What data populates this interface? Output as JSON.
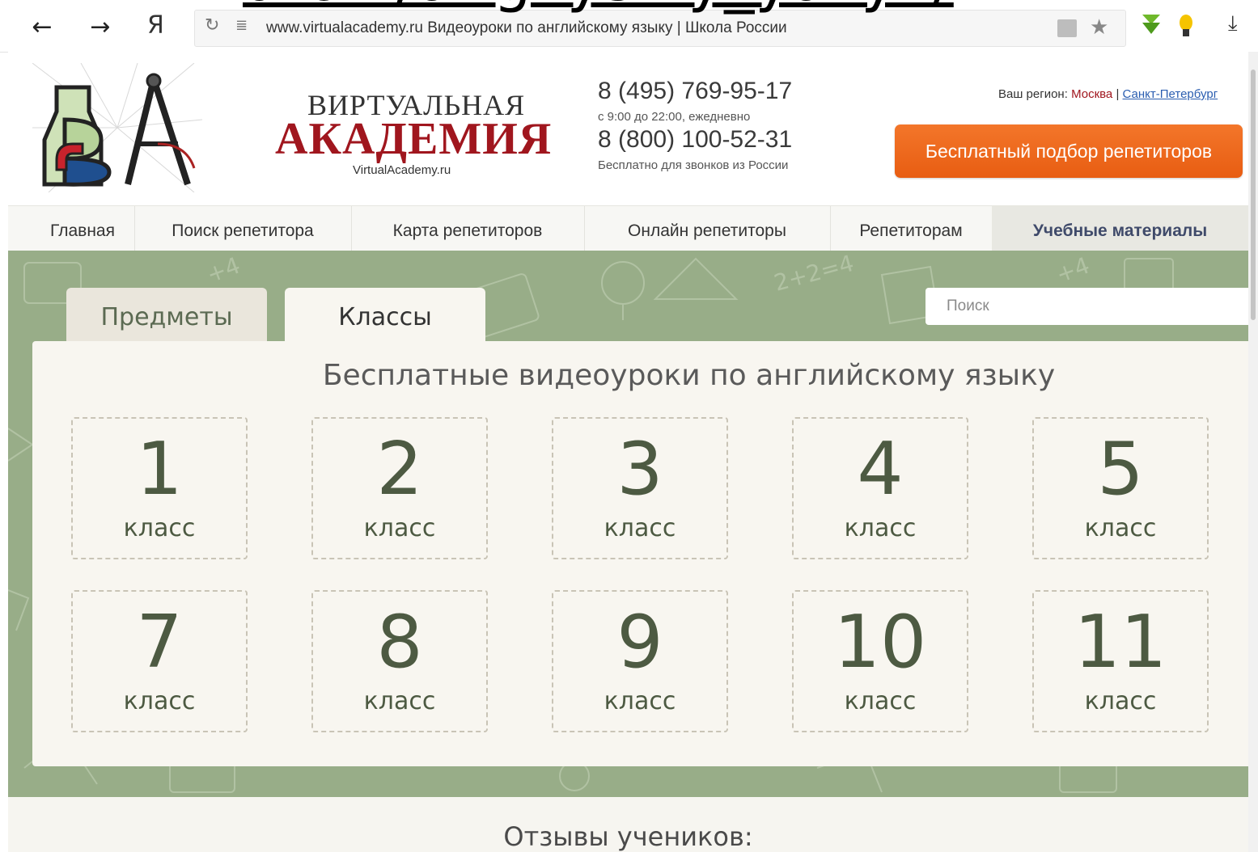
{
  "browser": {
    "url_text": "www.virtualacademy.ru   Видеоуроки по английскому языку | Школа России",
    "overlay_caption": "uroki/angliyskiy_yazyk/",
    "back_glyph": "←",
    "forward_glyph": "→",
    "yandex_glyph": "Я",
    "reload_glyph": "↻",
    "reader_glyph": "≣",
    "star_glyph": "★",
    "download_glyph": "⤓",
    "icons": [
      "back-arrow-icon",
      "forward-arrow-icon",
      "yandex-icon",
      "reload-icon",
      "reader-mode-icon",
      "lock-icon",
      "star-icon",
      "download-extension-icon",
      "bulb-extension-icon",
      "download-icon"
    ]
  },
  "header": {
    "logo_line1": "ВИРТУАЛЬНАЯ",
    "logo_line2": "АКАДЕМИЯ",
    "logo_domain": "VirtualAcademy.ru",
    "phone1": "8 (495) 769-95-17",
    "phone1_note": "с 9:00 до 22:00, ежедневно",
    "phone2": "8 (800) 100-52-31",
    "phone2_note": "Бесплатно для звонков из России",
    "region_label": "Ваш регион:",
    "region_current": "Москва",
    "region_separator": "|",
    "region_other": "Санкт-Петербург",
    "cta_label": "Бесплатный подбор репетиторов",
    "colors": {
      "accent_red": "#a0161e",
      "cta_orange": "#ef6a1f",
      "link_blue": "#2a5db0"
    }
  },
  "nav": {
    "items": [
      {
        "label": "Главная"
      },
      {
        "label": "Поиск репетитора"
      },
      {
        "label": "Карта репетиторов"
      },
      {
        "label": "Онлайн репетиторы"
      },
      {
        "label": "Репетиторам"
      },
      {
        "label": "Учебные материалы"
      }
    ],
    "active_index": 5
  },
  "board": {
    "tabs": [
      {
        "label": "Предметы"
      },
      {
        "label": "Классы"
      }
    ],
    "selected_tab": "Классы",
    "search_placeholder": "Поиск",
    "heading": "Бесплатные видеоуроки по английскому языку",
    "grades": [
      {
        "num": "1",
        "word": "класс"
      },
      {
        "num": "2",
        "word": "класс"
      },
      {
        "num": "3",
        "word": "класс"
      },
      {
        "num": "4",
        "word": "класс"
      },
      {
        "num": "5",
        "word": "класс"
      },
      {
        "num": "7",
        "word": "класс"
      },
      {
        "num": "8",
        "word": "класс"
      },
      {
        "num": "9",
        "word": "класс"
      },
      {
        "num": "10",
        "word": "класс"
      },
      {
        "num": "11",
        "word": "класс"
      }
    ],
    "colors": {
      "board_green": "#98ad88",
      "panel_cream": "#f8f6f0",
      "grade_text": "#4d5a42"
    }
  },
  "reviews": {
    "heading": "Отзывы учеников:"
  }
}
